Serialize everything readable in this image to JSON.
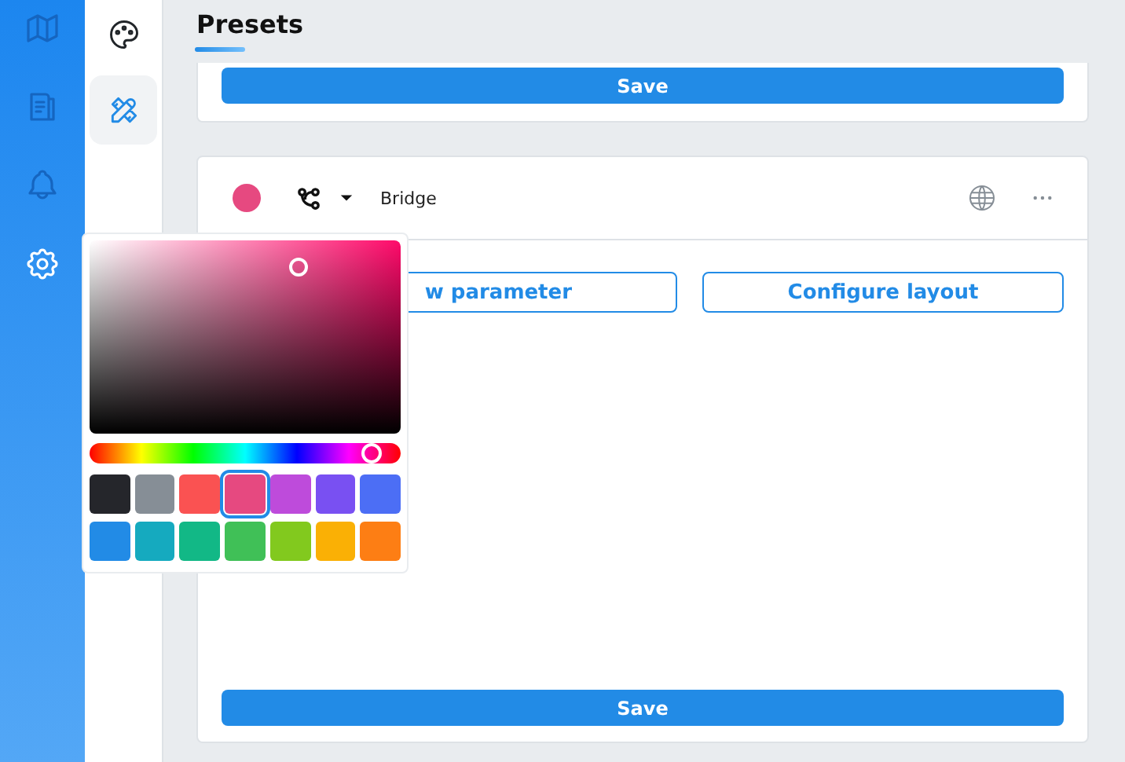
{
  "nav": [
    {
      "kind": "palette",
      "selected": false
    },
    {
      "kind": "tools",
      "selected": true
    }
  ],
  "title": "Presets",
  "top_card": {
    "save": "Save"
  },
  "preset": {
    "color": "#e64980",
    "name": "Bridge",
    "buttons": [
      "w parameter",
      "Configure layout"
    ],
    "save": "Save"
  },
  "color_picker": {
    "hue": {
      "level": 0.91
    },
    "swatches": [
      {
        "color": "#25262b",
        "selected": false
      },
      {
        "color": "#868e96",
        "selected": false
      },
      {
        "color": "#fa5252",
        "selected": false
      },
      {
        "color": "#e64980",
        "selected": true
      },
      {
        "color": "#be4bdb",
        "selected": false
      },
      {
        "color": "#7950f2",
        "selected": false
      },
      {
        "color": "#4c6ef5",
        "selected": false
      },
      {
        "color": "#228be6",
        "selected": false
      },
      {
        "color": "#15aabf",
        "selected": false
      },
      {
        "color": "#12b886",
        "selected": false
      },
      {
        "color": "#40c057",
        "selected": false
      },
      {
        "color": "#82c91e",
        "selected": false
      },
      {
        "color": "#fab005",
        "selected": false
      },
      {
        "color": "#fd7e14",
        "selected": false
      }
    ]
  }
}
